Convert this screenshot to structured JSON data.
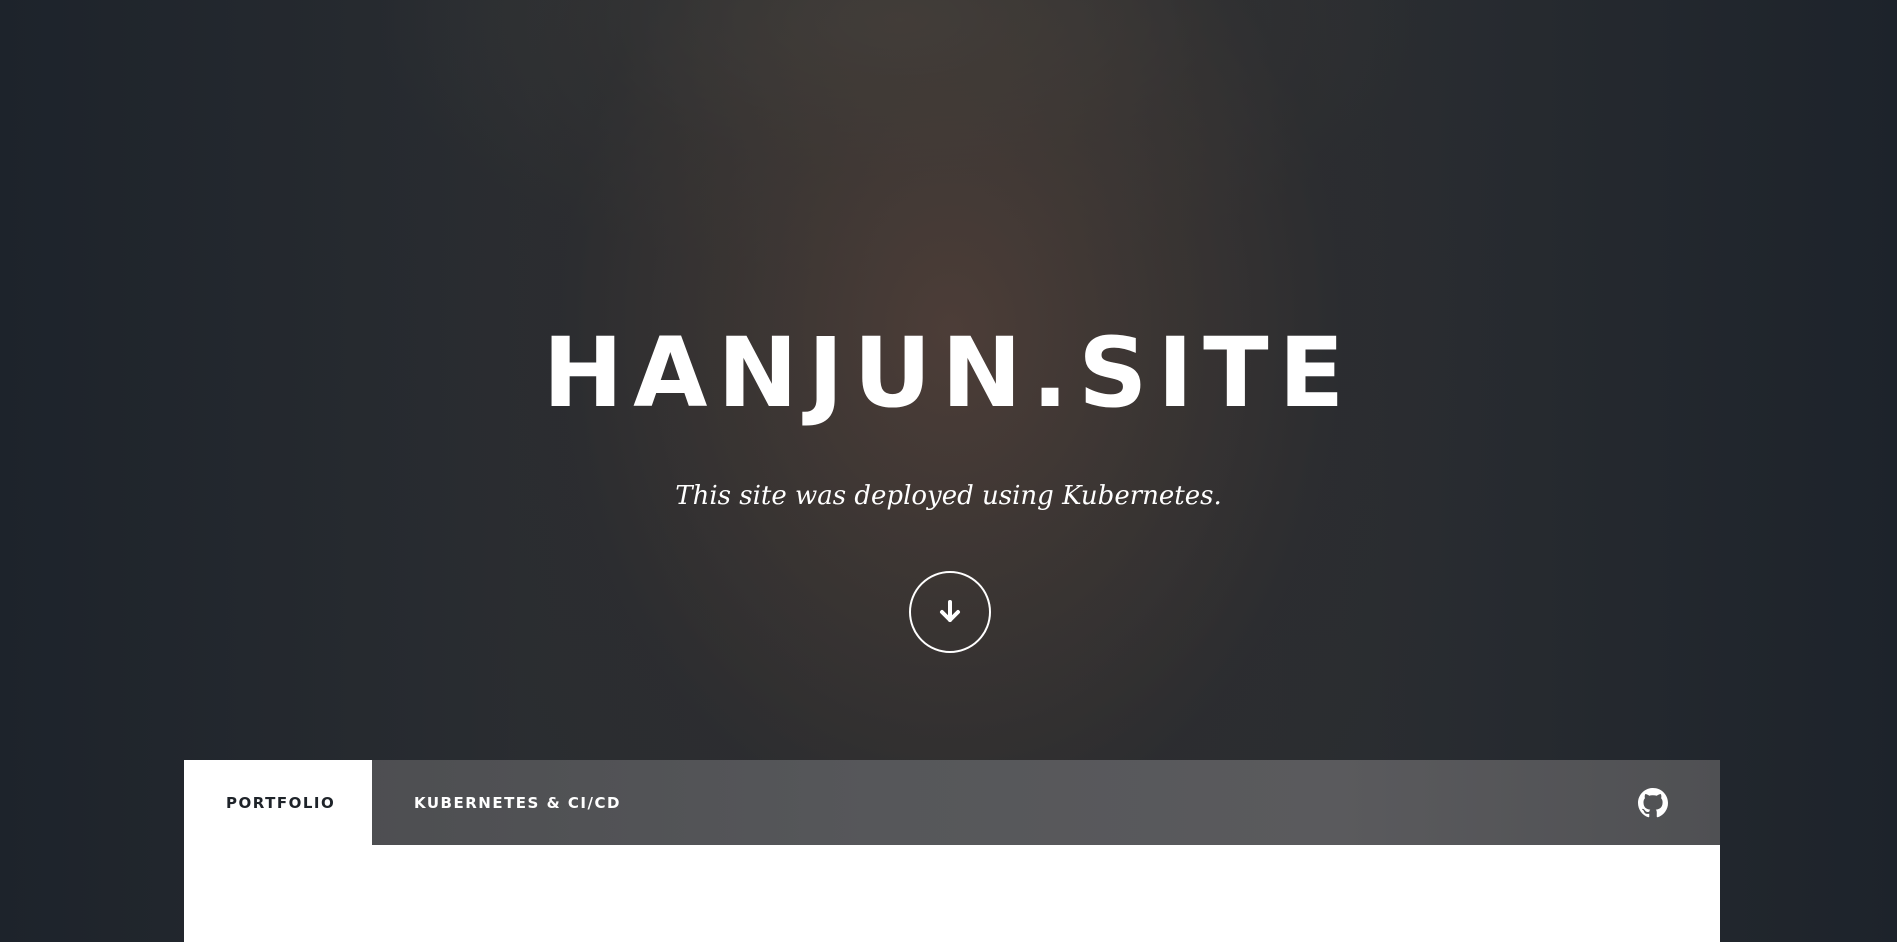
{
  "hero": {
    "title": "HANJUN.SITE",
    "subtitle": "This site was deployed using Kubernetes.",
    "scroll_icon": "arrow-down-icon"
  },
  "nav": {
    "tabs": [
      {
        "label": "PORTFOLIO",
        "active": true
      },
      {
        "label": "KUBERNETES & CI/CD",
        "active": false
      }
    ],
    "github_icon": "github-icon"
  },
  "colors": {
    "background_dark": "#1f252d",
    "nav_background": "#56575a",
    "active_tab_background": "#ffffff",
    "active_tab_text": "#1e2329",
    "text_light": "#ffffff"
  }
}
